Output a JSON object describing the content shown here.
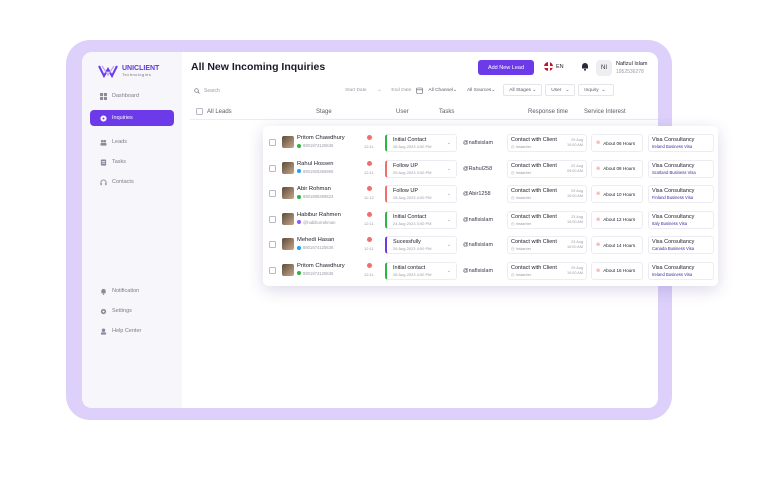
{
  "app": {
    "logo_name": "UNICLIENT",
    "logo_sub": "Technologies",
    "page_title": "All New Incoming Inquiries"
  },
  "sidebar": {
    "items": [
      {
        "label": "Dashboard",
        "icon": "grid-icon",
        "active": false
      },
      {
        "label": "Inquiries",
        "icon": "chat-icon",
        "active": true
      },
      {
        "label": "Leads",
        "icon": "people-icon",
        "active": false
      },
      {
        "label": "Tasks",
        "icon": "clipboard-icon",
        "active": false
      },
      {
        "label": "Contacts",
        "icon": "headset-icon",
        "active": false
      }
    ],
    "bottom_items": [
      {
        "label": "Notification",
        "icon": "bell-icon"
      },
      {
        "label": "Settings",
        "icon": "gear-icon"
      },
      {
        "label": "Help Center",
        "icon": "help-icon"
      }
    ]
  },
  "header": {
    "add_button": "Add New Lead",
    "language": "EN",
    "avatar_initials": "NI",
    "user_name": "Nafizul Islam",
    "user_phone": "1952536278"
  },
  "toolbar": {
    "search_placeholder": "Search",
    "start_date": "Start Date",
    "arrow": "→",
    "end_date": "End Date",
    "filters": [
      "All Channel",
      "All Sources",
      "All Stages",
      "User",
      "Inquiry"
    ]
  },
  "table": {
    "headers": [
      "All Leads",
      "Stage",
      "User",
      "Tasks",
      "Response time",
      "Service Interest"
    ]
  },
  "rows": [
    {
      "name": "Pritom Chawdhury",
      "phone": "8801674125636",
      "channel_color": "#2fb344",
      "time": "12:11",
      "stage": "Initial Contact",
      "stage_date": "28 Aug 2023  4:00 PM",
      "stage_color": "#2fb344",
      "user": "@nafisislam",
      "task": "Contact with Client",
      "task_sub": "Instanter",
      "task_date": "29 Aug",
      "task_time": "10:00 AM",
      "response": "About 06 Hours",
      "service": "Visa Consultancy",
      "service_sub": "Ireland Business Visa"
    },
    {
      "name": "Rahul Hossen",
      "phone": "8801925365969",
      "channel_color": "#1da1f2",
      "time": "12:11",
      "stage": "Follow UP",
      "stage_date": "29 Aug 2023  3:00 PM",
      "stage_color": "#f26d6d",
      "user": "@Rahul258",
      "task": "Contact with Client",
      "task_sub": "Instanter",
      "task_date": "22 Aug",
      "task_time": "09:00 AM",
      "response": "About 08 Hours",
      "service": "Visa Consultancy",
      "service_sub": "Scotland Business Visa"
    },
    {
      "name": "Abir Rohman",
      "phone": "8801695369623",
      "channel_color": "#2fb344",
      "time": "11:12",
      "stage": "Follow UP",
      "stage_date": "28 Aug 2023  4:00 PM",
      "stage_color": "#f26d6d",
      "user": "@Abir1258",
      "task": "Contact with Client",
      "task_sub": "Instanter",
      "task_date": "29 Aug",
      "task_time": "10:00 AM",
      "response": "About 10 Hours",
      "service": "Visa Consultancy",
      "service_sub": "Finland Business Visa"
    },
    {
      "name": "Habibur Rahmen",
      "phone": "@habiburrahman",
      "channel_color": "#8b5cf6",
      "time": "12:11",
      "stage": "Initial Contact",
      "stage_date": "24 Aug 2023  3:00 PM",
      "stage_color": "#2fb344",
      "user": "@nafisislam",
      "task": "Contact with Client",
      "task_sub": "Instanter",
      "task_date": "23 Aug",
      "task_time": "10:00 AM",
      "response": "About 12 Hours",
      "service": "Visa Consultancy",
      "service_sub": "Italy Business Visa"
    },
    {
      "name": "Mehedi Hasan",
      "phone": "8801674125636",
      "channel_color": "#1da1f2",
      "time": "12:11",
      "stage": "Sucessfully",
      "stage_date": "26 Aug 2023  4:00 PM",
      "stage_color": "#6c3ae8",
      "user": "@nafisislam",
      "task": "Contact with Client",
      "task_sub": "Instanter",
      "task_date": "23 Aug",
      "task_time": "10:00 AM",
      "response": "About 14 Hours",
      "service": "Visa Consultancy",
      "service_sub": "Canada Business Visa"
    },
    {
      "name": "Pritom Chawdhury",
      "phone": "8801674125636",
      "channel_color": "#2fb344",
      "time": "12:11",
      "stage": "Initial contact",
      "stage_date": "28 Aug 2023  4:00 PM",
      "stage_color": "#2fb344",
      "user": "@nafisislam",
      "task": "Contact with Client",
      "task_sub": "Instanter",
      "task_date": "29 Aug",
      "task_time": "10:00 AM",
      "response": "About 16 Hours",
      "service": "Visa Consultancy",
      "service_sub": "Ireland Business Visa"
    }
  ],
  "colors": {
    "accent": "#6c3ae8",
    "frame": "#ddd0fb"
  }
}
